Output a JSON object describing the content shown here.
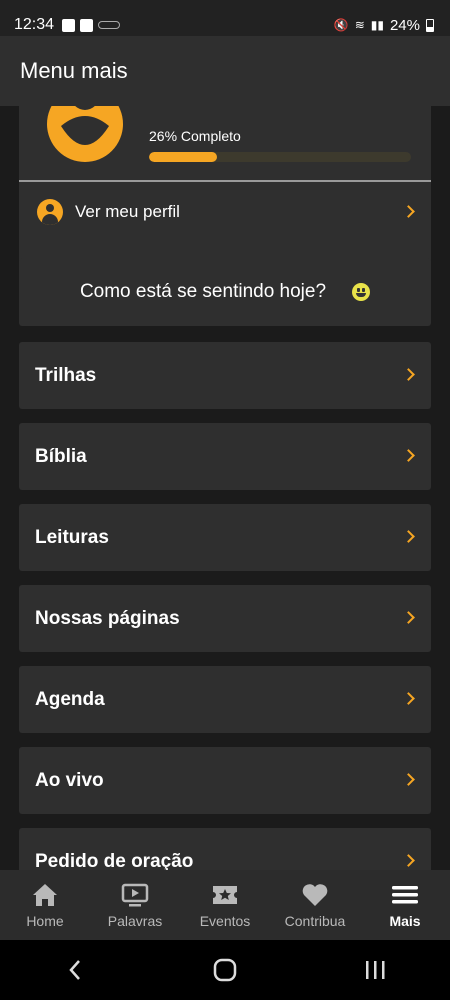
{
  "status_bar": {
    "time": "12:34",
    "battery": "24%"
  },
  "header": {
    "title": "Menu mais"
  },
  "profile": {
    "progress_label": "26% Completo",
    "progress_fraction": 0.26,
    "link_label": "Ver meu perfil"
  },
  "feeling": {
    "question": "Como está se sentindo hoje?"
  },
  "menu": {
    "items": [
      {
        "label": "Trilhas"
      },
      {
        "label": "Bíblia"
      },
      {
        "label": "Leituras"
      },
      {
        "label": "Nossas páginas"
      },
      {
        "label": "Agenda"
      },
      {
        "label": "Ao vivo"
      },
      {
        "label": "Pedido de oração"
      }
    ]
  },
  "bottom_nav": {
    "items": [
      {
        "label": "Home",
        "icon": "home-icon"
      },
      {
        "label": "Palavras",
        "icon": "play-screen-icon"
      },
      {
        "label": "Eventos",
        "icon": "ticket-star-icon"
      },
      {
        "label": "Contribua",
        "icon": "heart-icon"
      },
      {
        "label": "Mais",
        "icon": "menu-icon",
        "active": true
      }
    ]
  },
  "colors": {
    "accent": "#f6a623",
    "card": "#2f2f2f",
    "background": "#1b1b1b"
  }
}
